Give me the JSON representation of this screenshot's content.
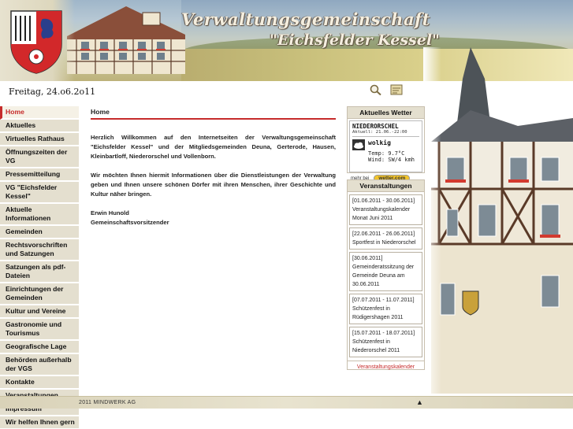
{
  "header": {
    "title_line1": "Verwaltungsgemeinschaft",
    "title_line2": "\"Eichsfelder Kessel\""
  },
  "date": "Freitag, 24.o6.2o11",
  "tools": {
    "icons": [
      "search-icon",
      "sitemap-icon"
    ]
  },
  "nav": {
    "items": [
      {
        "label": "Home"
      },
      {
        "label": "Aktuelles"
      },
      {
        "label": "Virtuelles Rathaus"
      },
      {
        "label": "Öffnungszeiten der VG"
      },
      {
        "label": "Pressemitteilung"
      },
      {
        "label": "VG \"Eichsfelder Kessel\""
      },
      {
        "label": "Aktuelle Informationen"
      },
      {
        "label": "Gemeinden"
      },
      {
        "label": "Rechtsvorschriften und Satzungen"
      },
      {
        "label": "Satzungen als pdf-Dateien"
      },
      {
        "label": "Einrichtungen der Gemeinden"
      },
      {
        "label": "Kultur und Vereine"
      },
      {
        "label": "Gastronomie und Tourismus"
      },
      {
        "label": "Geografische Lage"
      },
      {
        "label": "Behörden außerhalb der VGS"
      },
      {
        "label": "Kontakte"
      },
      {
        "label": "Veranstaltungen"
      },
      {
        "label": "Impressum"
      },
      {
        "label": "Wir helfen Ihnen gern"
      }
    ],
    "active_index": 0,
    "active_color": "#c62b2b"
  },
  "content": {
    "heading": "Home",
    "paragraph1": "Herzlich Willkommen auf den Internetseiten der Verwaltungsgemeinschaft \"Eichsfelder Kessel\" und der Mitgliedsgemeinden Deuna, Gerterode, Hausen, Kleinbartloff, Niederorschel und Vollenborn.",
    "paragraph2": "Wir möchten Ihnen hiermit Informationen über die Dienstleistungen der Verwaltung geben und Ihnen unsere schönen Dörfer mit ihren Menschen, ihrer Geschichte und Kultur näher bringen.",
    "signature_name": "Erwin Hunold",
    "signature_role": "Gemeinschaftsvorsitzender"
  },
  "weather": {
    "title": "Aktuelles Wetter",
    "location": "NIEDERORSCHEL",
    "updated": "Aktuell: 21.06.-22:00",
    "condition": "wolkig",
    "temp": "Temp: 9.7°C",
    "wind": "Wind: SW/4 kmh",
    "more_label": "mehr bei",
    "provider": "wetter.com",
    "icon": "cloud-icon"
  },
  "events": {
    "title": "Veranstaltungen",
    "items": [
      {
        "date": "[01.06.2011 - 30.06.2011]",
        "text": "Veranstaltungskalender Monat Juni 2011"
      },
      {
        "date": "[22.06.2011 - 26.06.2011]",
        "text": "Sportfest in Niederorschel"
      },
      {
        "date": "[30.06.2011]",
        "text": "Gemeinderatssitzung der Gemeinde Deuna am 30.06.2011"
      },
      {
        "date": "[07.07.2011 - 11.07.2011]",
        "text": "Schützenfest in Rüdigershagen 2011"
      },
      {
        "date": "[15.07.2011 - 18.07.2011]",
        "text": "Schützenfest in Niederorschel 2011"
      }
    ],
    "calendar_link": "Veranstaltungskalender"
  },
  "footer": {
    "text": "2011   MINDWERK AG",
    "up_arrow": "▲"
  }
}
